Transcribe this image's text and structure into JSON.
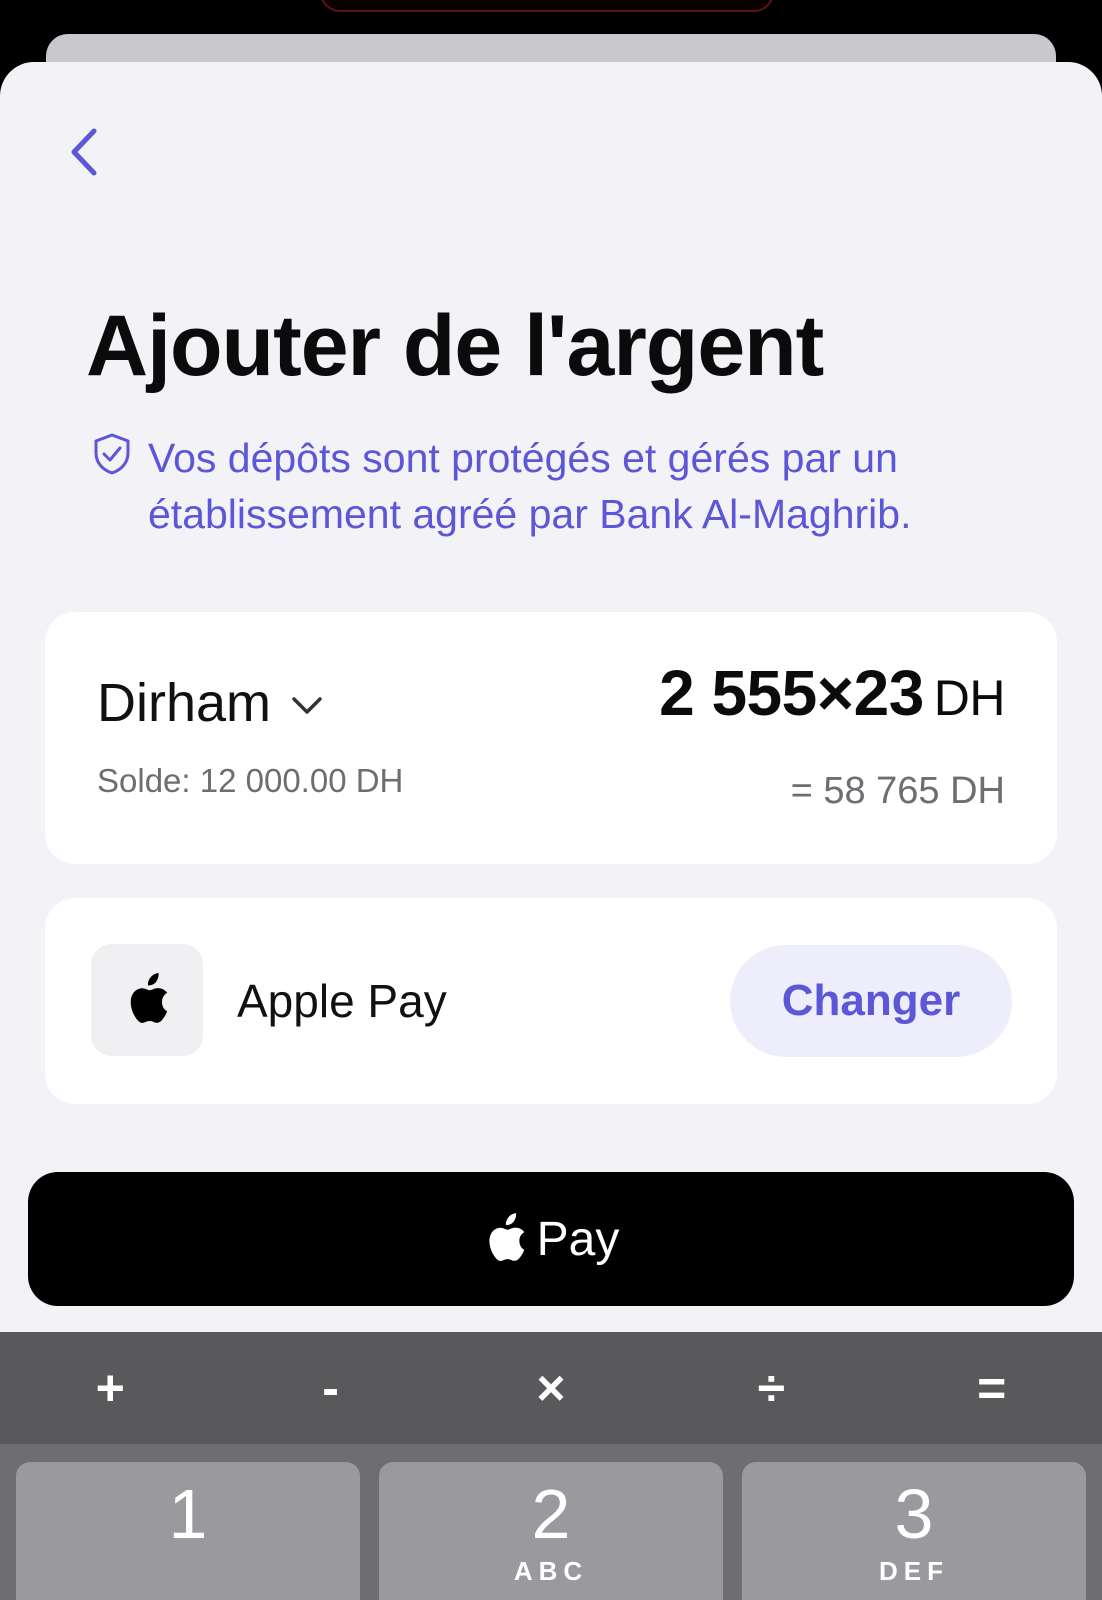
{
  "page": {
    "title": "Ajouter de l'argent",
    "notice": "Vos dépôts sont protégés et gérés par un établissement agréé par Bank Al-Maghrib."
  },
  "amount_card": {
    "currency": "Dirham",
    "balance": "Solde: 12 000.00 DH",
    "expression": "2 555×23",
    "unit": "DH",
    "result": "= 58 765 DH"
  },
  "payment_method": {
    "name": "Apple Pay",
    "change_label": "Changer",
    "icon": "apple-logo-icon"
  },
  "pay_button": {
    "label": "Pay"
  },
  "keyboard": {
    "operators": [
      "+",
      "-",
      "×",
      "÷",
      "="
    ],
    "keys": [
      {
        "digit": "1",
        "letters": ""
      },
      {
        "digit": "2",
        "letters": "ABC"
      },
      {
        "digit": "3",
        "letters": "DEF"
      }
    ]
  },
  "colors": {
    "accent": "#5b57d6",
    "background": "#f2f2f7",
    "card": "#ffffff",
    "pay_button": "#000000"
  }
}
